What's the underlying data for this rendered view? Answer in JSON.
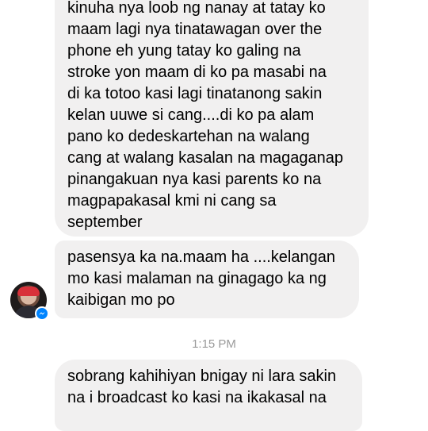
{
  "messages": [
    {
      "lines": [
        "kinuha nya loob ng nanay at tatay ko",
        "maam lagi nya tinatawagan over the",
        "phone eh yung tatay ko galing na",
        "stroke yon maam di ko pa masabi na",
        "di ka totoo kasi lagi tinatanong sakin",
        "kelan uuwe si cang....di ko pa alam",
        "pano ko dedeskartehan na walang",
        "cang at walang kasalan na magaganap",
        "pinangakuan nya kasi parents ko na",
        "magpapakasal kmi ni cang sa",
        "september"
      ]
    },
    {
      "lines": [
        "pasensya ka na.maam ha ....kelangan",
        "mo kasi malaman na ginagago ka ng",
        "kaibigan mo po"
      ]
    },
    {
      "lines": [
        "sobrang kahihiyan bnigay ni lara sakin",
        "na i broadcast ko kasi na ikakasal na"
      ]
    }
  ],
  "timestamp": "1:15 PM",
  "sender": {
    "avatar_icon": "profile-photo",
    "badge_icon": "messenger-icon"
  },
  "colors": {
    "bubble": "#f1f0f0",
    "text": "#000000",
    "timestamp": "#9a9a9a",
    "badge": "#0084ff"
  }
}
